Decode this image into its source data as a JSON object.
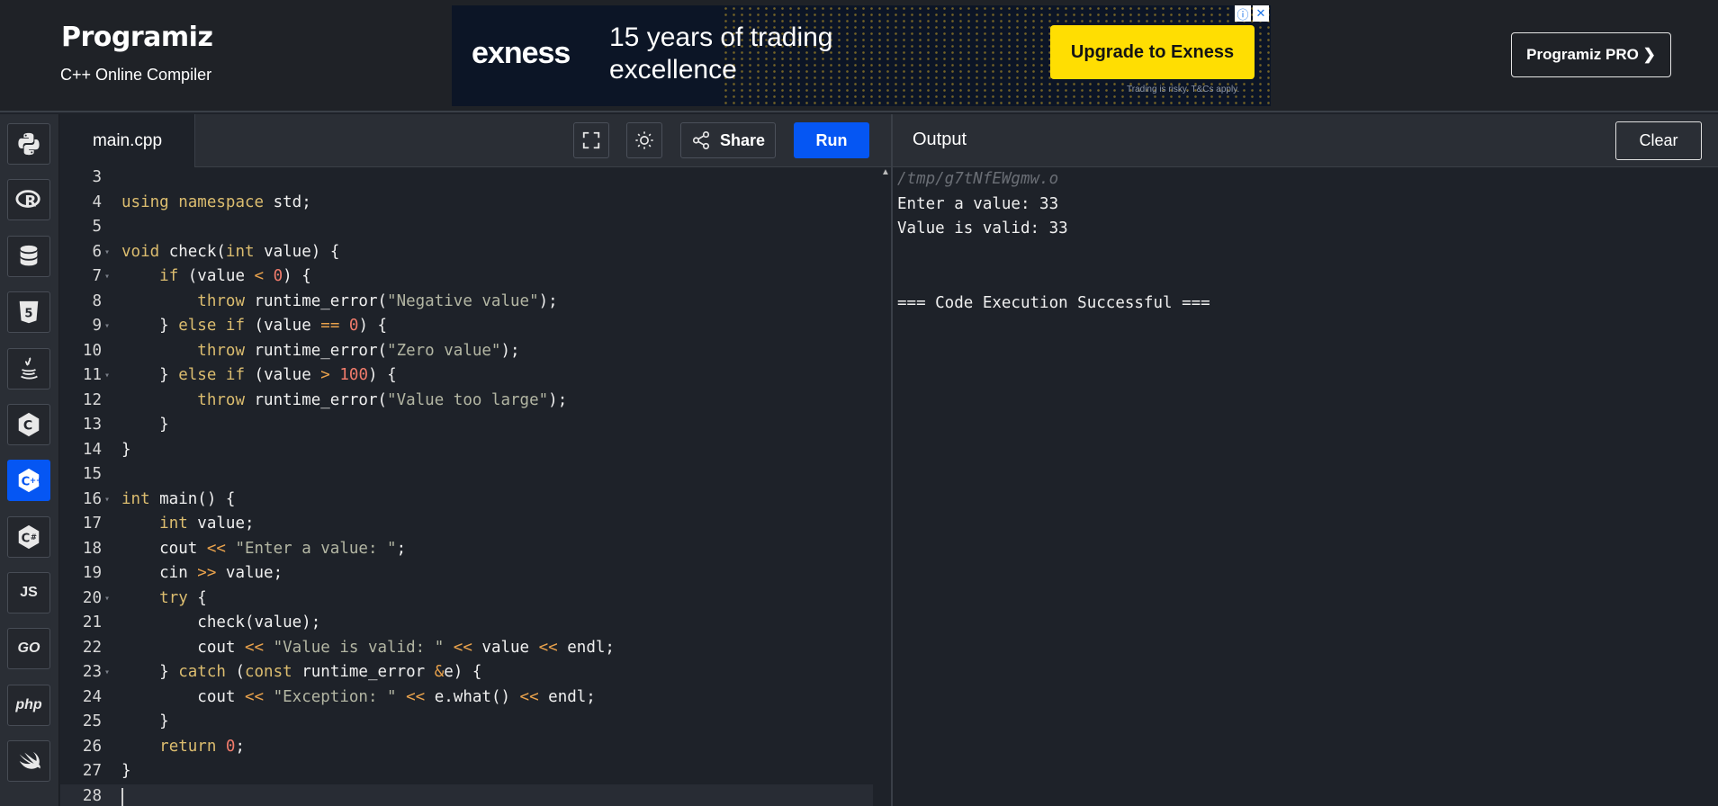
{
  "header": {
    "logo": "Programiz",
    "subtitle": "C++ Online Compiler",
    "pro_button": "Programiz PRO ❯"
  },
  "ad": {
    "brand": "exness",
    "headline": "15 years of trading excellence",
    "cta": "Upgrade to Exness",
    "disclaimer": "Trading is risky. T&Cs apply.",
    "info_icon": "ⓘ",
    "close_icon": "✕"
  },
  "sidebar": {
    "languages": [
      {
        "name": "python",
        "label": ""
      },
      {
        "name": "r",
        "label": "R"
      },
      {
        "name": "sql",
        "label": ""
      },
      {
        "name": "html",
        "label": "5"
      },
      {
        "name": "java",
        "label": ""
      },
      {
        "name": "c",
        "label": "C"
      },
      {
        "name": "cpp",
        "label": "C++",
        "active": true
      },
      {
        "name": "csharp",
        "label": "C#"
      },
      {
        "name": "javascript",
        "label": "JS"
      },
      {
        "name": "go",
        "label": "GO"
      },
      {
        "name": "php",
        "label": "php"
      },
      {
        "name": "swift",
        "label": ""
      }
    ]
  },
  "editor": {
    "file_tab": "main.cpp",
    "share_label": "Share",
    "run_label": "Run",
    "lines": [
      {
        "n": "3",
        "fold": false,
        "html": ""
      },
      {
        "n": "4",
        "fold": false,
        "html": "<span class=\"kw\">using</span> <span class=\"kw\">namespace</span> std;"
      },
      {
        "n": "5",
        "fold": false,
        "html": ""
      },
      {
        "n": "6",
        "fold": true,
        "html": "<span class=\"kw\">void</span> check(<span class=\"kw\">int</span> value) {"
      },
      {
        "n": "7",
        "fold": true,
        "html": "    <span class=\"kw\">if</span> (value <span class=\"op\">&lt;</span> <span class=\"num\">0</span>) {"
      },
      {
        "n": "8",
        "fold": false,
        "html": "        <span class=\"kw\">throw</span> runtime_error(<span class=\"str\">\"Negative value\"</span>);"
      },
      {
        "n": "9",
        "fold": true,
        "html": "    } <span class=\"kw\">else</span> <span class=\"kw\">if</span> (value <span class=\"op\">==</span> <span class=\"num\">0</span>) {"
      },
      {
        "n": "10",
        "fold": false,
        "html": "        <span class=\"kw\">throw</span> runtime_error(<span class=\"str\">\"Zero value\"</span>);"
      },
      {
        "n": "11",
        "fold": true,
        "html": "    } <span class=\"kw\">else</span> <span class=\"kw\">if</span> (value <span class=\"op\">&gt;</span> <span class=\"num\">100</span>) {"
      },
      {
        "n": "12",
        "fold": false,
        "html": "        <span class=\"kw\">throw</span> runtime_error(<span class=\"str\">\"Value too large\"</span>);"
      },
      {
        "n": "13",
        "fold": false,
        "html": "    }"
      },
      {
        "n": "14",
        "fold": false,
        "html": "}"
      },
      {
        "n": "15",
        "fold": false,
        "html": ""
      },
      {
        "n": "16",
        "fold": true,
        "html": "<span class=\"kw\">int</span> main() {"
      },
      {
        "n": "17",
        "fold": false,
        "html": "    <span class=\"kw\">int</span> value;"
      },
      {
        "n": "18",
        "fold": false,
        "html": "    cout <span class=\"op\">&lt;&lt;</span> <span class=\"str\">\"Enter a value: \"</span>;"
      },
      {
        "n": "19",
        "fold": false,
        "html": "    cin <span class=\"op\">&gt;&gt;</span> value;"
      },
      {
        "n": "20",
        "fold": true,
        "html": "    <span class=\"kw\">try</span> {"
      },
      {
        "n": "21",
        "fold": false,
        "html": "        check(value);"
      },
      {
        "n": "22",
        "fold": false,
        "html": "        cout <span class=\"op\">&lt;&lt;</span> <span class=\"str\">\"Value is valid: \"</span> <span class=\"op\">&lt;&lt;</span> value <span class=\"op\">&lt;&lt;</span> endl;"
      },
      {
        "n": "23",
        "fold": true,
        "html": "    } <span class=\"kw\">catch</span> (<span class=\"kw\">const</span> runtime_error <span class=\"op\">&amp;</span>e) {"
      },
      {
        "n": "24",
        "fold": false,
        "html": "        cout <span class=\"op\">&lt;&lt;</span> <span class=\"str\">\"Exception: \"</span> <span class=\"op\">&lt;&lt;</span> e.what() <span class=\"op\">&lt;&lt;</span> endl;"
      },
      {
        "n": "25",
        "fold": false,
        "html": "    }"
      },
      {
        "n": "26",
        "fold": false,
        "html": "    <span class=\"kw\">return</span> <span class=\"num\">0</span>;"
      },
      {
        "n": "27",
        "fold": false,
        "html": "}"
      },
      {
        "n": "28",
        "fold": false,
        "html": "",
        "current": true
      }
    ]
  },
  "output": {
    "title": "Output",
    "clear_label": "Clear",
    "lines": [
      {
        "text": "/tmp/g7tNfEWgmw.o",
        "kind": "path"
      },
      {
        "text": "Enter a value: 33",
        "kind": "normal"
      },
      {
        "text": "Value is valid: 33",
        "kind": "normal"
      },
      {
        "text": "",
        "kind": "normal"
      },
      {
        "text": "",
        "kind": "normal"
      },
      {
        "text": "=== Code Execution Successful ===",
        "kind": "normal"
      }
    ]
  },
  "colors": {
    "accent": "#0556f3",
    "background": "#1e2229",
    "panel": "#2a2e35",
    "keyword": "#dcbd6f",
    "string": "#b3b6a3",
    "number": "#f07b6b",
    "ad_cta": "#ffde02"
  }
}
